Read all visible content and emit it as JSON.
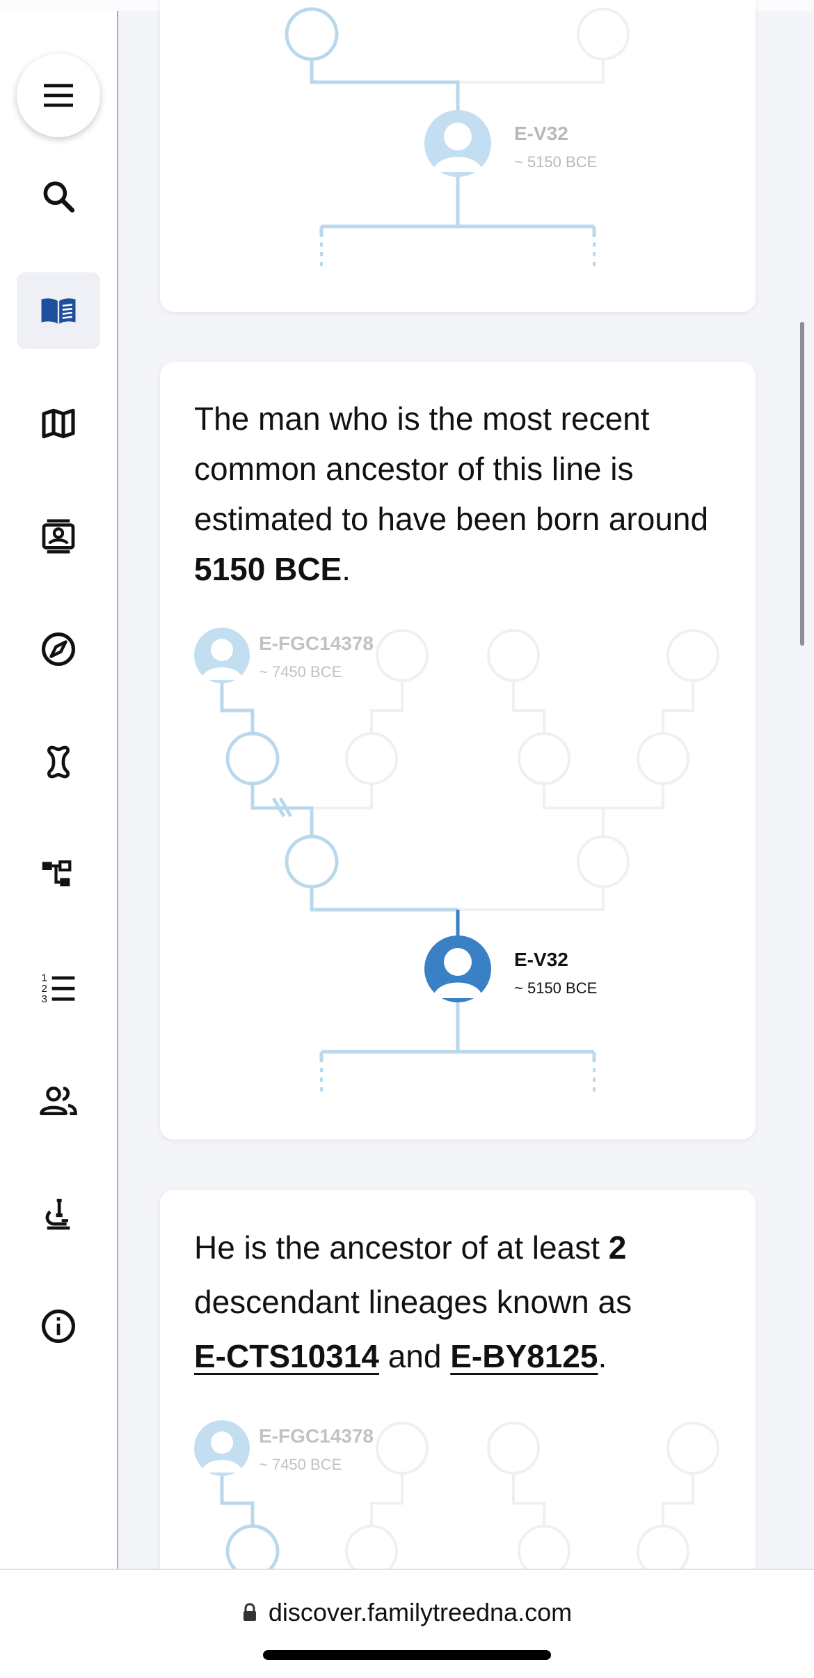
{
  "sidebar": {
    "items": [
      {
        "icon": "menu-icon"
      },
      {
        "icon": "search-icon"
      },
      {
        "icon": "book-icon",
        "active": true
      },
      {
        "icon": "map-icon"
      },
      {
        "icon": "profile-card-icon"
      },
      {
        "icon": "compass-icon"
      },
      {
        "icon": "bone-icon"
      },
      {
        "icon": "tree-structure-icon"
      },
      {
        "icon": "numbered-list-icon"
      },
      {
        "icon": "people-icon"
      },
      {
        "icon": "microscope-icon"
      },
      {
        "icon": "info-icon"
      }
    ]
  },
  "card1": {
    "node_name": "E-V32",
    "node_date": "~ 5150 BCE"
  },
  "card2": {
    "text_before": "The man who is the most recent common ancestor of this line is estimated to have been born around ",
    "text_bold": "5150 BCE",
    "text_after": ".",
    "root_name": "E-FGC14378",
    "root_date": "~ 7450 BCE",
    "node_name": "E-V32",
    "node_date": "~ 5150 BCE"
  },
  "card3": {
    "text_before": "He is the ancestor of at least ",
    "count": "2",
    "text_mid": " descendant lineages known as",
    "link1": "E-CTS10314",
    "and": " and ",
    "link2": "E-BY8125",
    "text_after": ".",
    "root_name": "E-FGC14378",
    "root_date": "~ 7450 BCE"
  },
  "browser": {
    "url": "discover.familytreedna.com"
  },
  "colors": {
    "accent": "#3a80c5",
    "light_line": "#b9d8ec",
    "faint_line": "#eef0f3",
    "nav_icon": "#111111",
    "active_icon": "#1f4f9c"
  }
}
